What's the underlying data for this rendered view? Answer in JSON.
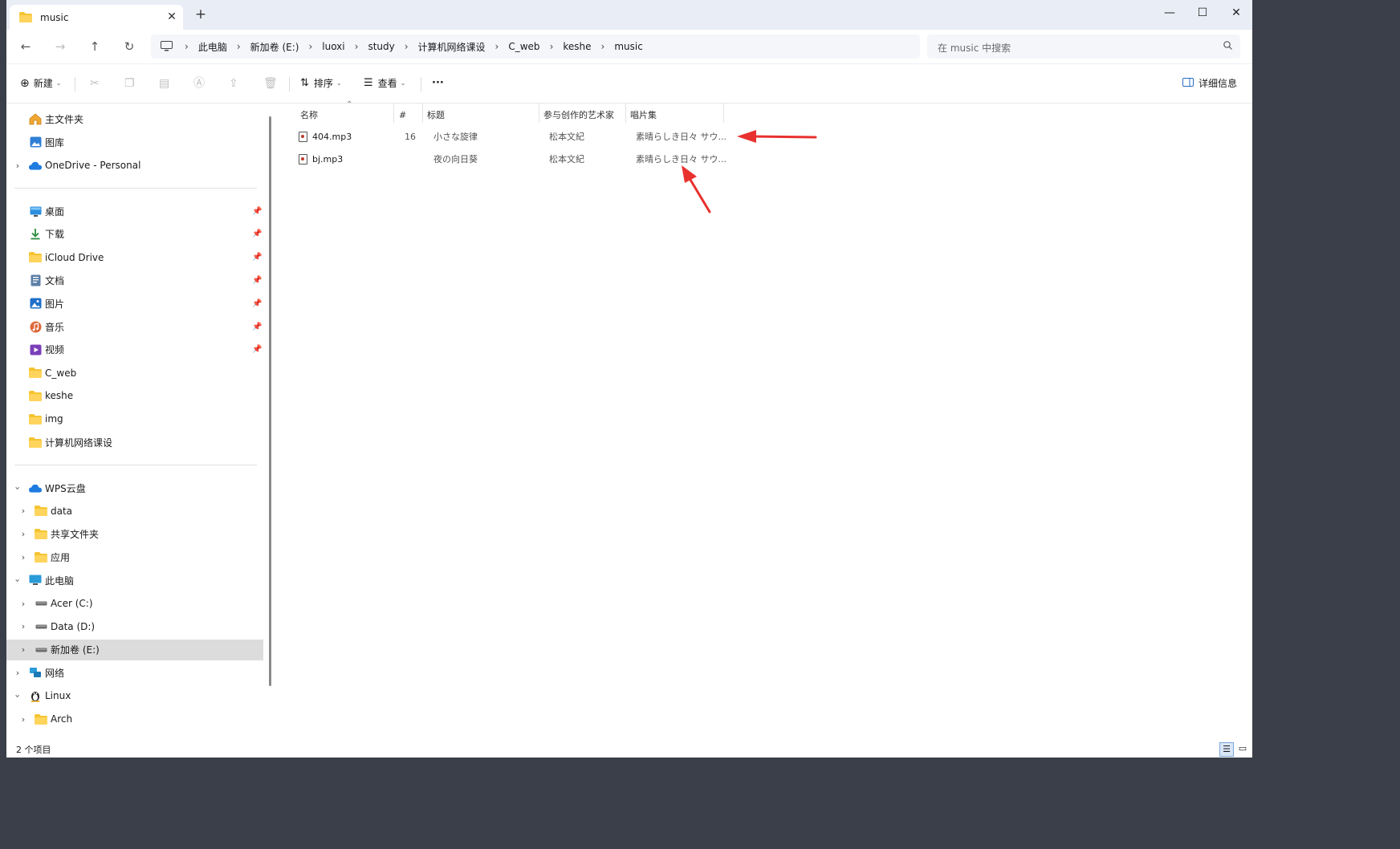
{
  "tab": {
    "title": "music",
    "close": "✕",
    "add": "+"
  },
  "window_buttons": {
    "minimize": "—",
    "maximize": "☐",
    "close": "✕"
  },
  "nav": {
    "back": "←",
    "forward": "→",
    "up": "↑",
    "refresh": "↻"
  },
  "breadcrumb": [
    "此电脑",
    "新加卷 (E:)",
    "luoxi",
    "study",
    "计算机网络课设",
    "C_web",
    "keshe",
    "music"
  ],
  "search": {
    "placeholder": "在 music 中搜索"
  },
  "toolbar": {
    "new": "新建",
    "sort": "排序",
    "view": "查看",
    "more": "···",
    "details": "详细信息"
  },
  "sidebar": {
    "top": [
      {
        "label": "主文件夹",
        "icon": "home-icon"
      },
      {
        "label": "图库",
        "icon": "gallery-icon"
      },
      {
        "label": "OneDrive - Personal",
        "icon": "cloud-icon",
        "expandable": true
      }
    ],
    "pinned": [
      {
        "label": "桌面",
        "icon": "desktop-icon",
        "pinned": true
      },
      {
        "label": "下载",
        "icon": "download-icon",
        "pinned": true
      },
      {
        "label": "iCloud Drive",
        "icon": "folder-icon",
        "pinned": true
      },
      {
        "label": "文档",
        "icon": "document-icon",
        "pinned": true
      },
      {
        "label": "图片",
        "icon": "pictures-icon",
        "pinned": true
      },
      {
        "label": "音乐",
        "icon": "music-icon",
        "pinned": true
      },
      {
        "label": "视频",
        "icon": "video-icon",
        "pinned": true
      },
      {
        "label": "C_web",
        "icon": "folder-icon"
      },
      {
        "label": "keshe",
        "icon": "folder-icon"
      },
      {
        "label": "img",
        "icon": "folder-icon"
      },
      {
        "label": "计算机网络课设",
        "icon": "folder-icon"
      }
    ],
    "tree": [
      {
        "label": "WPS云盘",
        "icon": "cloud-icon",
        "level": 0,
        "state": "expanded"
      },
      {
        "label": "data",
        "icon": "folder-icon",
        "level": 1,
        "state": "collapsed"
      },
      {
        "label": "共享文件夹",
        "icon": "folder-icon",
        "level": 1,
        "state": "collapsed"
      },
      {
        "label": "应用",
        "icon": "folder-icon",
        "level": 1,
        "state": "collapsed"
      },
      {
        "label": "此电脑",
        "icon": "computer-icon",
        "level": 0,
        "state": "expanded"
      },
      {
        "label": "Acer (C:)",
        "icon": "drive-icon",
        "level": 1,
        "state": "collapsed"
      },
      {
        "label": "Data (D:)",
        "icon": "drive-icon",
        "level": 1,
        "state": "collapsed"
      },
      {
        "label": "新加卷 (E:)",
        "icon": "drive-icon",
        "level": 1,
        "state": "collapsed",
        "selected": true
      },
      {
        "label": "网络",
        "icon": "network-icon",
        "level": 0,
        "state": "collapsed"
      },
      {
        "label": "Linux",
        "icon": "linux-icon",
        "level": 0,
        "state": "expanded"
      },
      {
        "label": "Arch",
        "icon": "folder-icon",
        "level": 1,
        "state": "collapsed"
      }
    ]
  },
  "columns": {
    "name": "名称",
    "track": "#",
    "title": "标题",
    "artist": "参与创作的艺术家",
    "album": "唱片集"
  },
  "files": [
    {
      "name": "404.mp3",
      "track": "16",
      "title": "小さな旋律",
      "artist": "松本文紀",
      "album": "素晴らしき日々 サウ..."
    },
    {
      "name": "bj.mp3",
      "track": "",
      "title": "夜の向日葵",
      "artist": "松本文紀",
      "album": "素晴らしき日々 サウ..."
    }
  ],
  "status": {
    "count": "2 个项目"
  },
  "colors": {
    "folder": "#f4c430",
    "annotation": "#e8312f",
    "selected": "#dcdcdc"
  }
}
